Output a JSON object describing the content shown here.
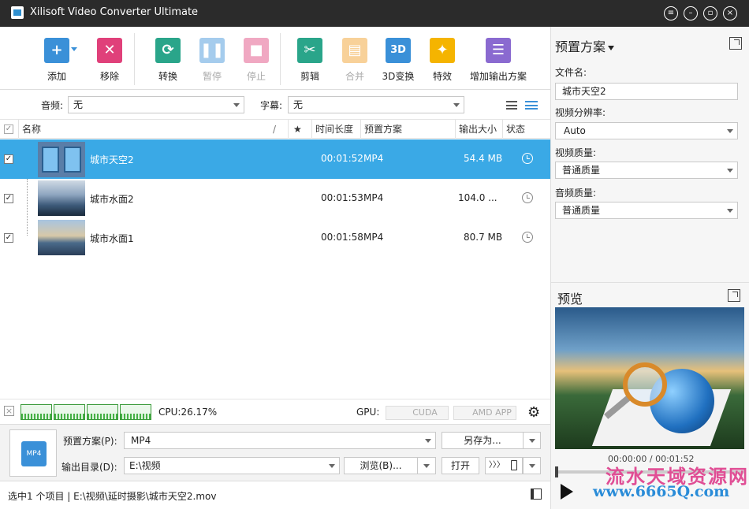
{
  "window": {
    "title": "Xilisoft Video Converter Ultimate"
  },
  "toolbar": {
    "add": "添加",
    "remove": "移除",
    "convert": "转换",
    "pause": "暂停",
    "stop": "停止",
    "clip": "剪辑",
    "merge": "合并",
    "threed": "3D变换",
    "effects": "特效",
    "add_profile": "增加输出方案",
    "threed_icon_text": "3D"
  },
  "filter": {
    "audio_label": "音频:",
    "audio_value": "无",
    "subtitle_label": "字幕:",
    "subtitle_value": "无"
  },
  "table": {
    "headers": {
      "name": "名称",
      "sort": "/",
      "star": "★",
      "duration": "时间长度",
      "profile": "预置方案",
      "size": "输出大小",
      "status": "状态"
    },
    "rows": [
      {
        "name": "城市天空2",
        "duration": "00:01:52",
        "profile": "MP4",
        "size": "54.4 MB",
        "checked": true
      },
      {
        "name": "城市水面2",
        "duration": "00:01:53",
        "profile": "MP4",
        "size": "104.0 ...",
        "checked": true
      },
      {
        "name": "城市水面1",
        "duration": "00:01:58",
        "profile": "MP4",
        "size": "80.7 MB",
        "checked": true
      }
    ]
  },
  "cpu": {
    "text": "CPU:26.17%",
    "gpu_label": "GPU:",
    "cuda": "CUDA",
    "amd": "AMD APP"
  },
  "output": {
    "profile_label": "预置方案(P):",
    "profile_value": "MP4",
    "save_as": "另存为...",
    "dir_label": "输出目录(D):",
    "dir_value": "E:\\视频",
    "browse": "浏览(B)...",
    "open": "打开",
    "chevrons": "〉〉〉",
    "icon_text": "MP4"
  },
  "status": {
    "text": "选中1 个项目 | E:\\视频\\延时摄影\\城市天空2.mov"
  },
  "right": {
    "title": "预置方案",
    "filename_label": "文件名:",
    "filename_value": "城市天空2",
    "resolution_label": "视频分辨率:",
    "resolution_value": "Auto",
    "vquality_label": "视频质量:",
    "vquality_value": "普通质量",
    "aquality_label": "音频质量:",
    "aquality_value": "普通质量",
    "preview_title": "预览",
    "time": "00:00:00 / 00:01:52"
  },
  "watermark": {
    "line1": "流水天域资源网",
    "line2": "www.6665Q.com"
  }
}
